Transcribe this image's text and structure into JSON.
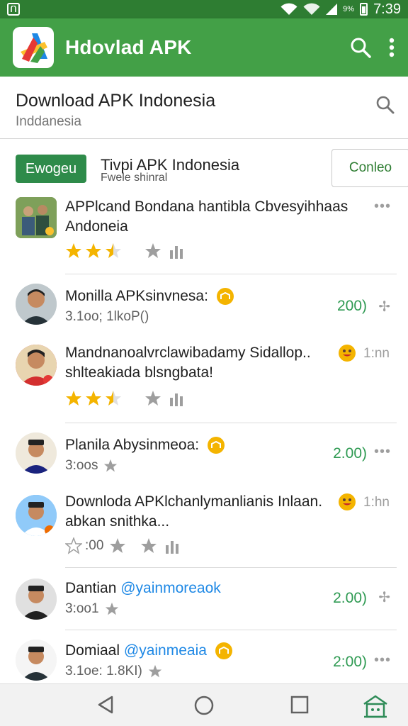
{
  "status_bar": {
    "battery_text": "9%",
    "time": "7:39",
    "left_icon": "notification-box-icon"
  },
  "app_bar": {
    "title": "Hdovlad APK",
    "logo": "app-logo",
    "actions": [
      "search-icon",
      "more-vert-icon"
    ],
    "color": "#43a047"
  },
  "search_card": {
    "title": "Download APK Indonesia",
    "subtitle": "Inddanesia"
  },
  "filter": {
    "badge": "Ewogeu",
    "title": "Tivpi APK Indonesia",
    "subtitle": "Fwele shinral",
    "button": "Conleo"
  },
  "items": [
    {
      "title_line1": "APPlcand Bondana hantibla Cbvesyihhaas",
      "title_line2": "Andoneia",
      "rating": 2.5,
      "meta_suffix": ""
    },
    {
      "title_line1": "Monilla APKsinvnesa:",
      "meta": "3.1oo; 1lkoP()",
      "count": "200)"
    },
    {
      "title_line1": "Mandnanoalvrclawibadamy Sidallop..",
      "title_line2": "shlteakiada blsngbata!",
      "time": "1:nn",
      "rating": 2.5
    },
    {
      "title_line1": "Planila Abysinmeoa:",
      "meta": "3:oos",
      "count": "2.00)"
    },
    {
      "title_line1": "Downloda APKlchanlymanlianis Inlaan.",
      "title_line2": "abkan snithka...",
      "time": "1:hn",
      "meta": ":00"
    },
    {
      "title_name": "Dantian",
      "title_mention": "@yainmoreaok",
      "meta": "3:oo1",
      "count": "2.00)"
    },
    {
      "title_name": "Domiaal",
      "title_mention": "@yainmeaia",
      "meta": "3.1oe: 1.8KI)",
      "count": "2:00)"
    }
  ],
  "nav_bar": {
    "buttons": [
      "back-icon",
      "home-icon",
      "recents-icon",
      "store-icon"
    ]
  }
}
